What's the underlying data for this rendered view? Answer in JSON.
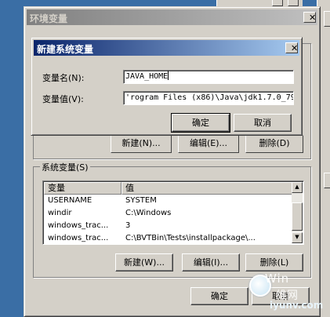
{
  "outer_window": {
    "title": "环境变量",
    "system_group_label": "系统变量(S)",
    "columns": [
      "变量",
      "值"
    ],
    "rows": [
      {
        "name": "USERNAME",
        "value": "SYSTEM"
      },
      {
        "name": "windir",
        "value": "C:\\Windows"
      },
      {
        "name": "windows_trac...",
        "value": "3"
      },
      {
        "name": "windows_trac...",
        "value": "C:\\BVTBin\\Tests\\installpackage\\..."
      }
    ],
    "buttons": {
      "new": "新建(W)...",
      "edit": "编辑(I)...",
      "delete": "删除(L)",
      "ok": "确定",
      "cancel": "取消"
    },
    "ghost_buttons": {
      "new": "新建(N)...",
      "edit": "编辑(E)...",
      "delete": "删除(D)"
    }
  },
  "dialog": {
    "title": "新建系统变量",
    "name_label": "变量名(N):",
    "name_value": "JAVA_HOME",
    "value_label": "变量值(V):",
    "value_value": "'rogram Files (x86)\\Java\\jdk1.7.0_79",
    "ok": "确定",
    "cancel": "取消"
  },
  "watermark": {
    "line1": "Win",
    "line2": "维网",
    "line3": "iyunv.com"
  },
  "icons": {
    "close": "✕",
    "scroll_up": "▲",
    "scroll_down": "▼"
  }
}
